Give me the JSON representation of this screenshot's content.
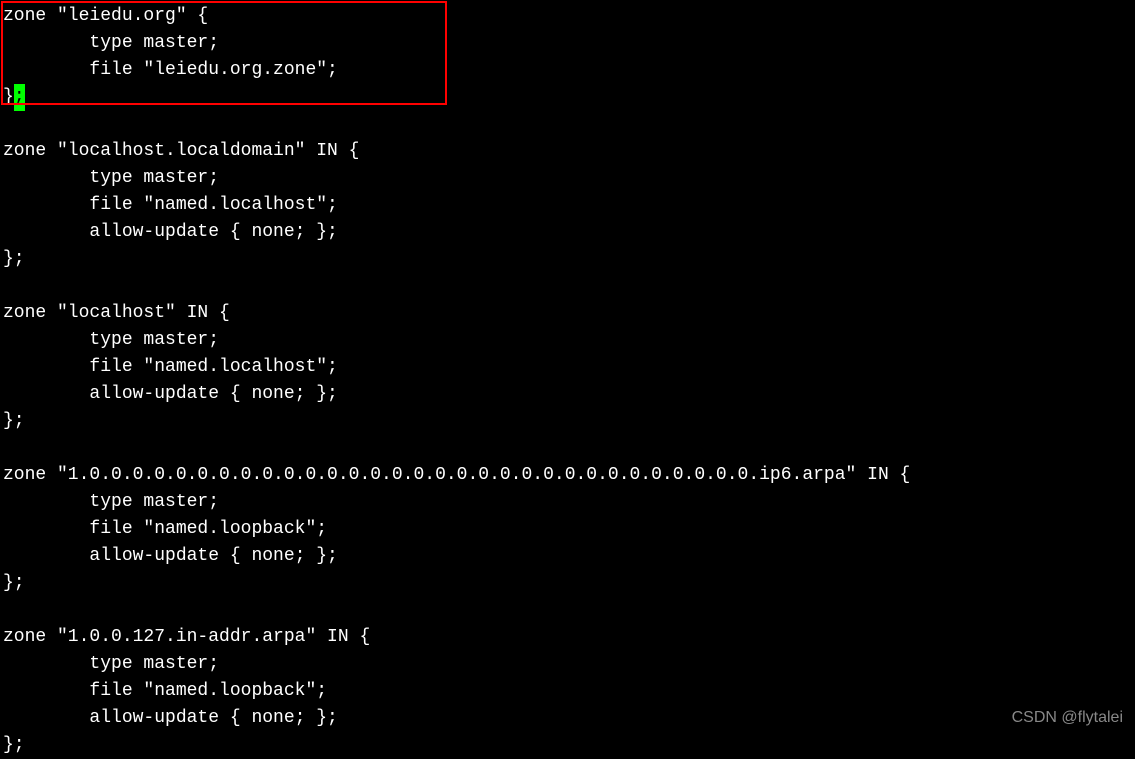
{
  "terminal": {
    "blocks": [
      {
        "lines": [
          "zone \"leiedu.org\" {",
          "        type master;",
          "        file \"leiedu.org.zone\";",
          "}"
        ],
        "hasCursor": true,
        "cursorChar": ";"
      },
      {
        "lines": [
          "zone \"localhost.localdomain\" IN {",
          "        type master;",
          "        file \"named.localhost\";",
          "        allow-update { none; };",
          "};"
        ],
        "hasCursor": false
      },
      {
        "lines": [
          "zone \"localhost\" IN {",
          "        type master;",
          "        file \"named.localhost\";",
          "        allow-update { none; };",
          "};"
        ],
        "hasCursor": false
      },
      {
        "lines": [
          "zone \"1.0.0.0.0.0.0.0.0.0.0.0.0.0.0.0.0.0.0.0.0.0.0.0.0.0.0.0.0.0.0.0.ip6.arpa\" IN {",
          "        type master;",
          "        file \"named.loopback\";",
          "        allow-update { none; };",
          "};"
        ],
        "hasCursor": false
      },
      {
        "lines": [
          "zone \"1.0.0.127.in-addr.arpa\" IN {",
          "        type master;",
          "        file \"named.loopback\";",
          "        allow-update { none; };",
          "};"
        ],
        "hasCursor": false
      }
    ]
  },
  "watermark": "CSDN @flytalei"
}
